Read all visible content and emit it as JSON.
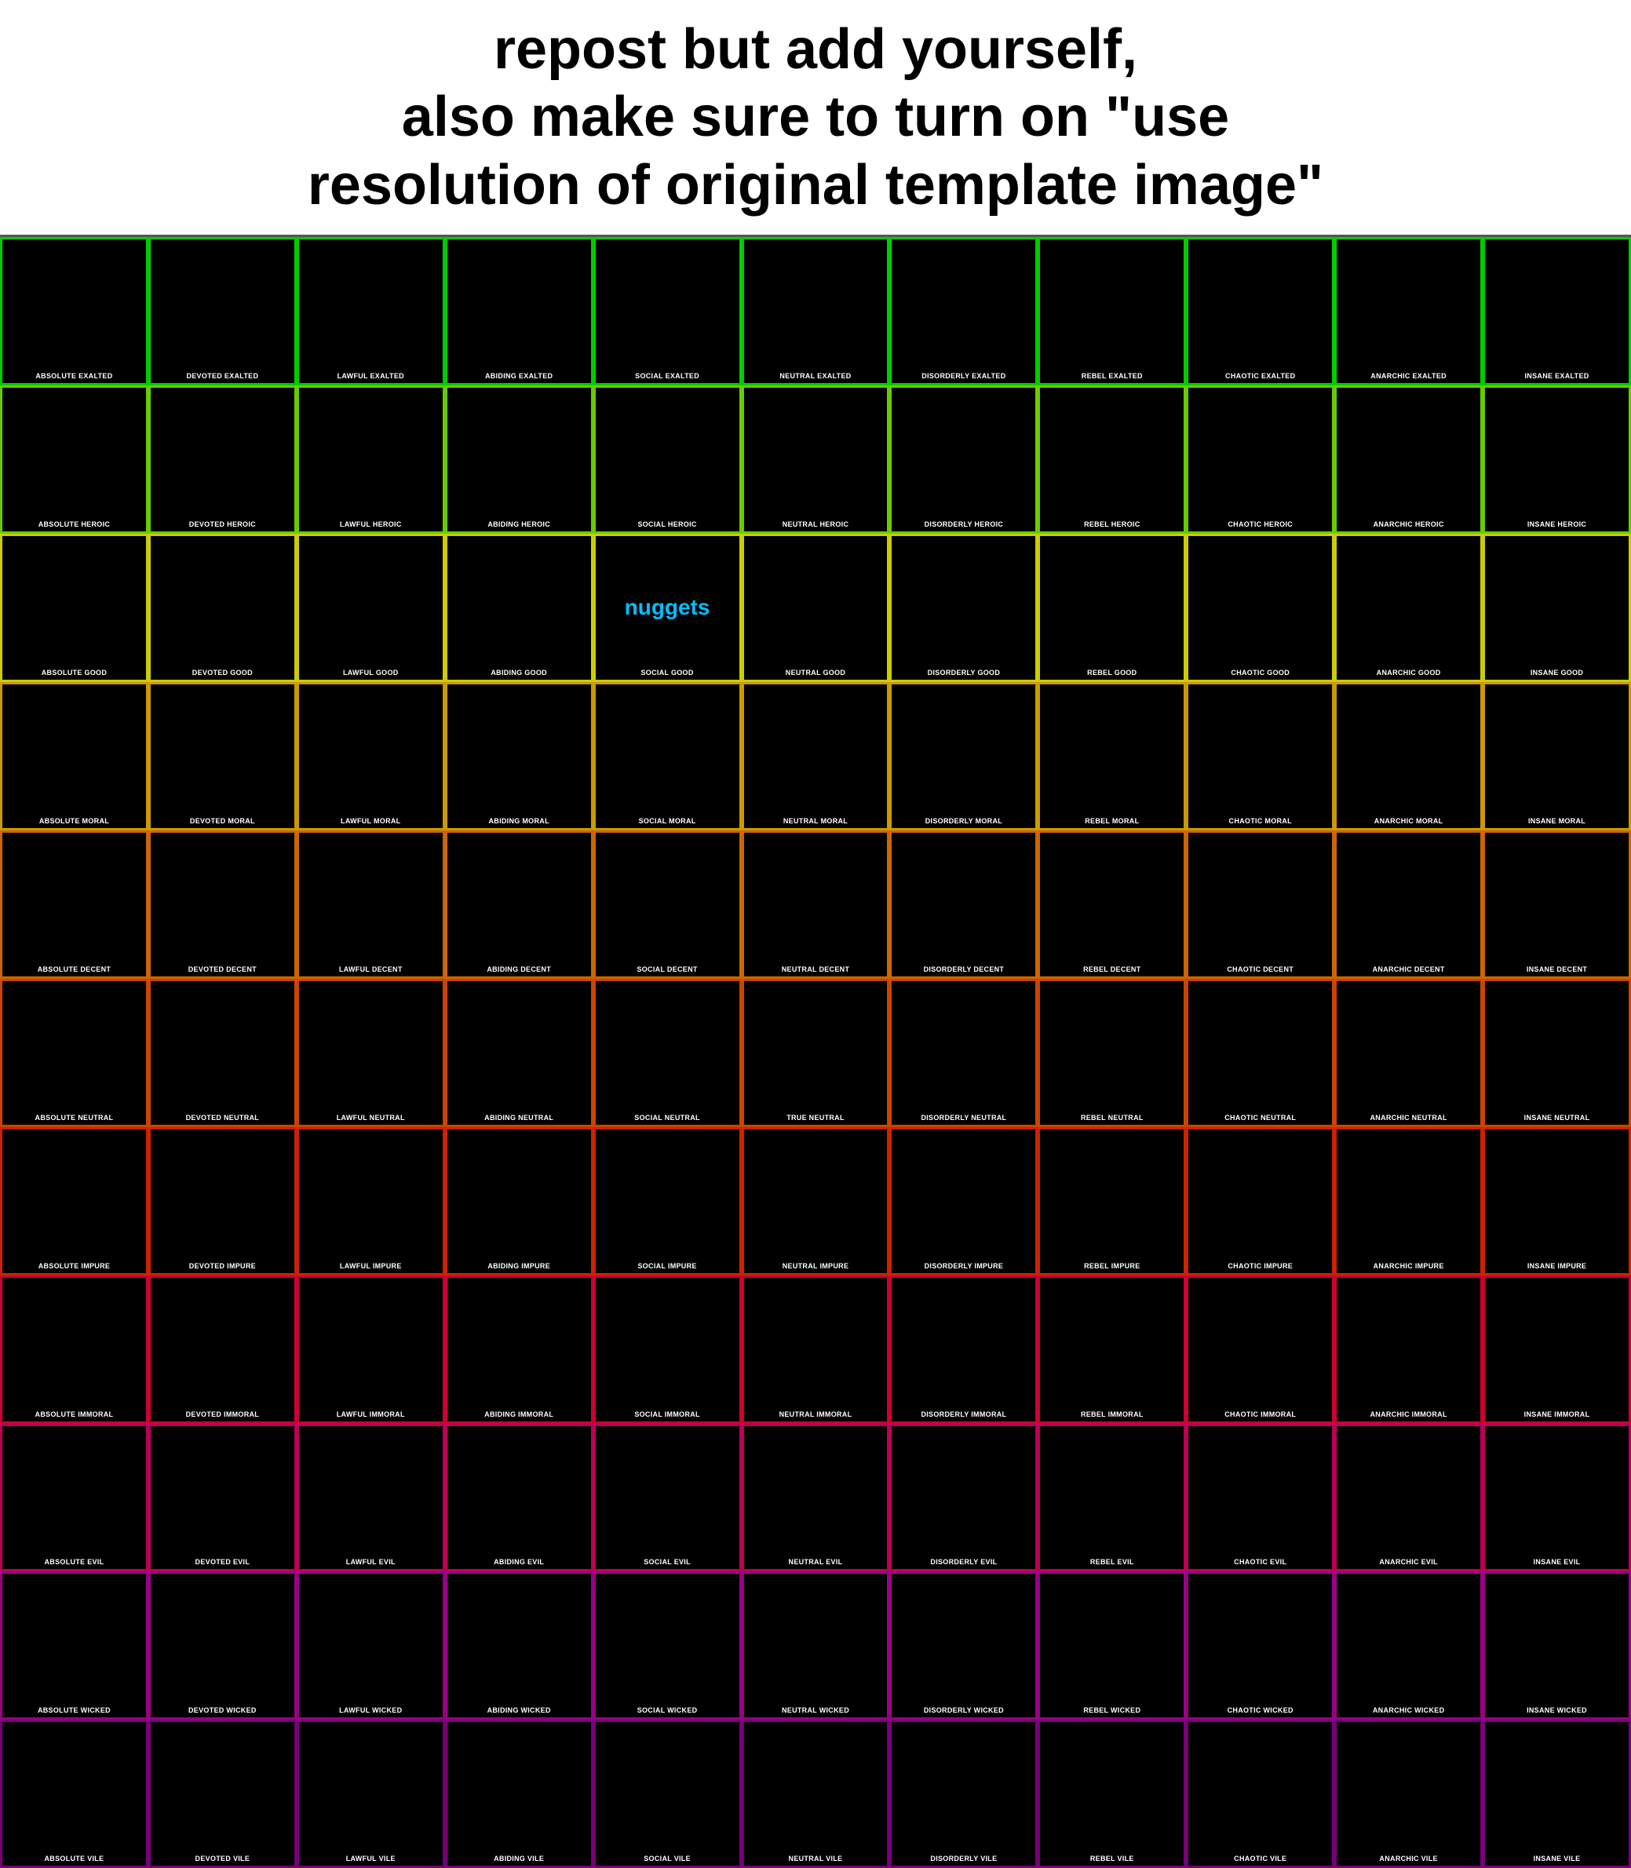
{
  "header": {
    "line1": "repost but add yourself,",
    "line2": "also make sure to turn on \"use",
    "line3": "resolution of original template image\""
  },
  "grid": {
    "columns": [
      "ABSOLUTE",
      "DEVOTED",
      "LAWFUL",
      "ABIDING",
      "SOCIAL",
      "NEUTRAL",
      "DISORDERLY",
      "REBEL",
      "CHAOTIC",
      "ANARCHIC",
      "INSANE"
    ],
    "rows": [
      "EXALTED",
      "HEROIC",
      "GOOD",
      "MORAL",
      "DECENT",
      "NEUTRAL",
      "IMPURE",
      "IMMORAL",
      "EVIL",
      "WICKED",
      "VILE"
    ],
    "special_cell": {
      "row": 2,
      "col": 4,
      "text": "nuggets"
    },
    "row_colors": [
      "#00cc00",
      "#66cc00",
      "#cccc00",
      "#cc9900",
      "#cc6600",
      "#cc4400",
      "#cc2200",
      "#cc0033",
      "#bb0055",
      "#990088",
      "#770077"
    ]
  }
}
